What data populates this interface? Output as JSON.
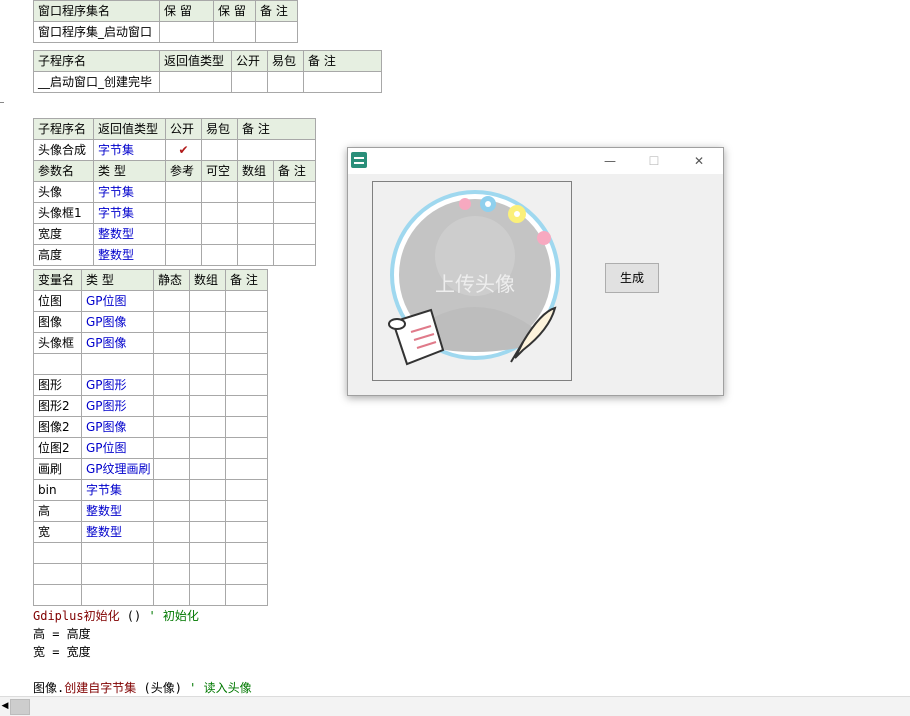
{
  "t1": {
    "header": [
      "窗口程序集名",
      "保 留",
      "保 留",
      "备 注"
    ],
    "row": [
      "窗口程序集_启动窗口",
      "",
      "",
      ""
    ]
  },
  "t2": {
    "header": [
      "子程序名",
      "返回值类型",
      "公开",
      "易包",
      "备 注"
    ],
    "row": [
      "__启动窗口_创建完毕",
      "",
      "",
      "",
      ""
    ]
  },
  "t3": {
    "header": [
      "子程序名",
      "返回值类型",
      "公开",
      "易包",
      "备 注"
    ],
    "row": [
      "头像合成",
      "字节集",
      "✔",
      "",
      ""
    ],
    "param_header": [
      "参数名",
      "类 型",
      "参考",
      "可空",
      "数组",
      "备 注"
    ],
    "params": [
      [
        "头像",
        "字节集"
      ],
      [
        "头像框1",
        "字节集"
      ],
      [
        "宽度",
        "整数型"
      ],
      [
        "高度",
        "整数型"
      ]
    ]
  },
  "t4": {
    "header": [
      "变量名",
      "类 型",
      "静态",
      "数组",
      "备 注"
    ],
    "rows": [
      [
        "位图",
        "GP位图"
      ],
      [
        "图像",
        "GP图像"
      ],
      [
        "头像框",
        "GP图像"
      ],
      [
        "",
        ""
      ],
      [
        "图形",
        "GP图形"
      ],
      [
        "图形2",
        "GP图形"
      ],
      [
        "图像2",
        "GP图像"
      ],
      [
        "位图2",
        "GP位图"
      ],
      [
        "画刷",
        "GP纹理画刷"
      ],
      [
        "bin",
        "字节集"
      ],
      [
        "高",
        "整数型"
      ],
      [
        "宽",
        "整数型"
      ],
      [
        "",
        ""
      ],
      [
        "",
        ""
      ],
      [
        "",
        ""
      ]
    ]
  },
  "code": {
    "l1_fn": "Gdiplus初始化",
    "l1_args": " () ",
    "l1_comment": "' 初始化",
    "l2": "高 = 高度",
    "l3": "宽 = 宽度",
    "l4_obj": "图像.",
    "l4_fn": "创建自字节集",
    "l4_args": " (头像) ",
    "l4_comment": "' 读入头像"
  },
  "dialog": {
    "minimize": "—",
    "maximize": "☐",
    "close": "✕",
    "upload_text": "上传头像",
    "button": "生成"
  },
  "colors": {
    "header_bg": "#e6efe1",
    "type_blue": "#0000cc",
    "function_red": "#800000",
    "comment_green": "#007800"
  },
  "icons": [
    "app-icon",
    "scroll-icon",
    "quill-pen-icon",
    "flower-icon"
  ]
}
